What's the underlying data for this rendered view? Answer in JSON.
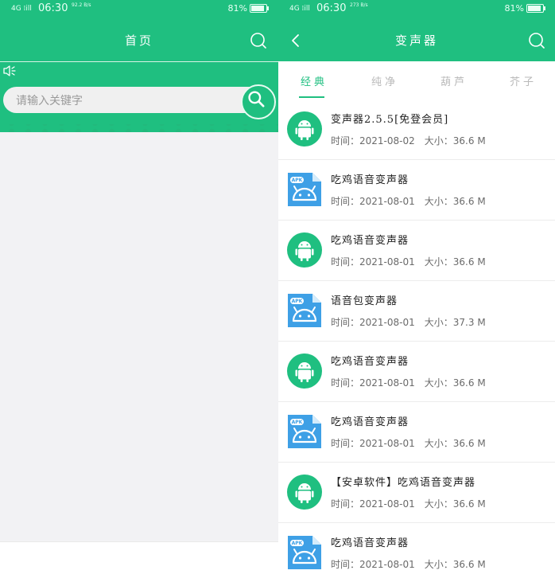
{
  "status": {
    "signal": "4G ⁞ill",
    "time": "06:30",
    "speed": "92.2 B/s",
    "speed_right": "273 B/s",
    "battery": "81%"
  },
  "left": {
    "title": "首页",
    "search_placeholder": "请输入关键字"
  },
  "right": {
    "title": "变声器",
    "tabs": [
      "经典",
      "纯净",
      "葫芦",
      "芥子"
    ],
    "active_tab": "经典",
    "time_label": "时间：",
    "size_label": "大小：",
    "items": [
      {
        "icon": "android-round-icon",
        "name": "变声器2.5.5[免登会员]",
        "date": "2021-08-02",
        "size": "36.6 M"
      },
      {
        "icon": "apk-file-icon",
        "name": "吃鸡语音变声器",
        "date": "2021-08-01",
        "size": "36.6 M"
      },
      {
        "icon": "android-round-icon",
        "name": "吃鸡语音变声器",
        "date": "2021-08-01",
        "size": "36.6 M"
      },
      {
        "icon": "apk-file-icon",
        "name": "语音包变声器",
        "date": "2021-08-01",
        "size": "37.3 M"
      },
      {
        "icon": "android-round-icon",
        "name": "吃鸡语音变声器",
        "date": "2021-08-01",
        "size": "36.6 M"
      },
      {
        "icon": "apk-file-icon",
        "name": "吃鸡语音变声器",
        "date": "2021-08-01",
        "size": "36.6 M"
      },
      {
        "icon": "android-round-icon",
        "name": "【安卓软件】吃鸡语音变声器",
        "date": "2021-08-01",
        "size": "36.6 M"
      },
      {
        "icon": "apk-file-icon",
        "name": "吃鸡语音变声器",
        "date": "2021-08-01",
        "size": "36.6 M"
      }
    ]
  },
  "colors": {
    "brand_green": "#1fbf80",
    "apk_blue": "#3ea0e6"
  }
}
